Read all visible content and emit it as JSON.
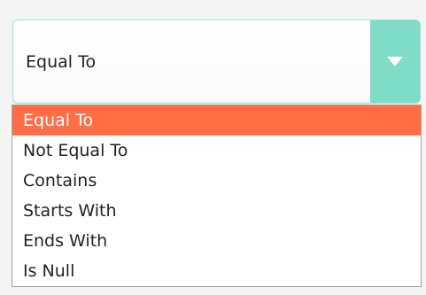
{
  "select": {
    "value": "Equal To",
    "toggle_icon": "triangle-down-icon",
    "colors": {
      "toggle_bg": "#7fdcc6",
      "border": "#9be3d1"
    }
  },
  "dropdown": {
    "selected_color": "#ff6e44",
    "options": [
      {
        "label": "Equal To",
        "selected": true
      },
      {
        "label": "Not Equal To",
        "selected": false
      },
      {
        "label": "Contains",
        "selected": false
      },
      {
        "label": "Starts With",
        "selected": false
      },
      {
        "label": "Ends With",
        "selected": false
      },
      {
        "label": "Is Null",
        "selected": false
      }
    ]
  }
}
